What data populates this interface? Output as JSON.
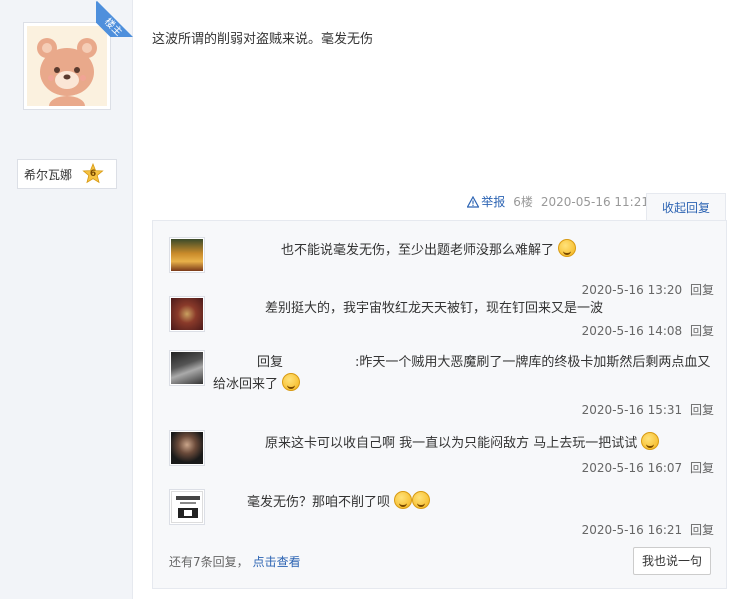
{
  "poster": {
    "badge": "楼主",
    "username": "希尔瓦娜",
    "level": "6"
  },
  "post": {
    "text": "这波所谓的削弱对盗贼来说。毫发无伤",
    "report_label": "举报",
    "floor": "6楼",
    "timestamp": "2020-05-16 11:21",
    "collapse_label": "收起回复"
  },
  "replies": [
    {
      "text": "也不能说毫发无伤，至少出题老师没那么难解了",
      "time": "2020-5-16 13:20",
      "reply_label": "回复"
    },
    {
      "text": "差别挺大的，我宇宙牧红龙天天被钉，现在钉回来又是一波",
      "time": "2020-5-16 14:08",
      "reply_label": "回复"
    },
    {
      "prefix": "回复",
      "text": ":昨天一个贼用大恶魔刷了一牌库的终极卡加斯然后剩两点血又给冰回来了",
      "time": "2020-5-16 15:31",
      "reply_label": "回复"
    },
    {
      "text": "原来这卡可以收自己啊 我一直以为只能闷敌方 马上去玩一把试试",
      "time": "2020-5-16 16:07",
      "reply_label": "回复"
    },
    {
      "text": "毫发无伤？那咱不削了呗",
      "time": "2020-5-16 16:21",
      "reply_label": "回复"
    }
  ],
  "footer": {
    "more_text": "还有7条回复，",
    "more_link": "点击查看",
    "say_button": "我也说一句"
  }
}
